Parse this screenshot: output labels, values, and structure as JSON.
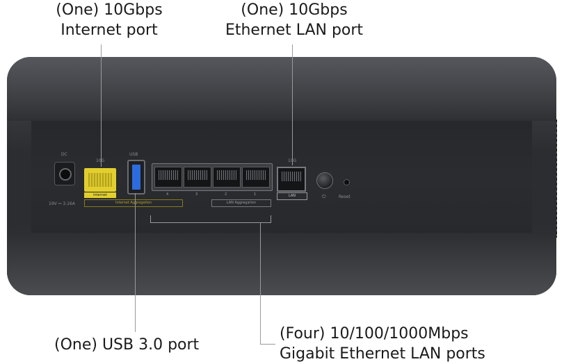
{
  "callouts": {
    "internet_port": {
      "line1": "(One) 10Gbps",
      "line2": "Internet port"
    },
    "ethernet_lan_port": {
      "line1": "(One) 10Gbps",
      "line2": "Ethernet LAN port"
    },
    "usb_port": {
      "line1": "(One) USB 3.0 port"
    },
    "gigabit_lan_ports": {
      "line1": "(Four) 10/100/1000Mbps",
      "line2": "Gigabit Ethernet LAN ports"
    }
  },
  "device_labels": {
    "dc": "DC",
    "dc_rating": "19V ⎓ 3.16A",
    "internet_speed": "10G",
    "usb_label": "USB",
    "internet": "Internet",
    "internet_aggregation": "Internet Aggregation",
    "lan_aggregation": "LAN Aggregation",
    "lan_numbers": [
      "4",
      "3",
      "2",
      "1"
    ],
    "lan_speed": "10G",
    "lan": "LAN",
    "reset": "Reset"
  },
  "colors": {
    "internet_port": "#e2cf2e",
    "usb_port": "#2d6cdf",
    "router_body": "#2b2d31"
  }
}
